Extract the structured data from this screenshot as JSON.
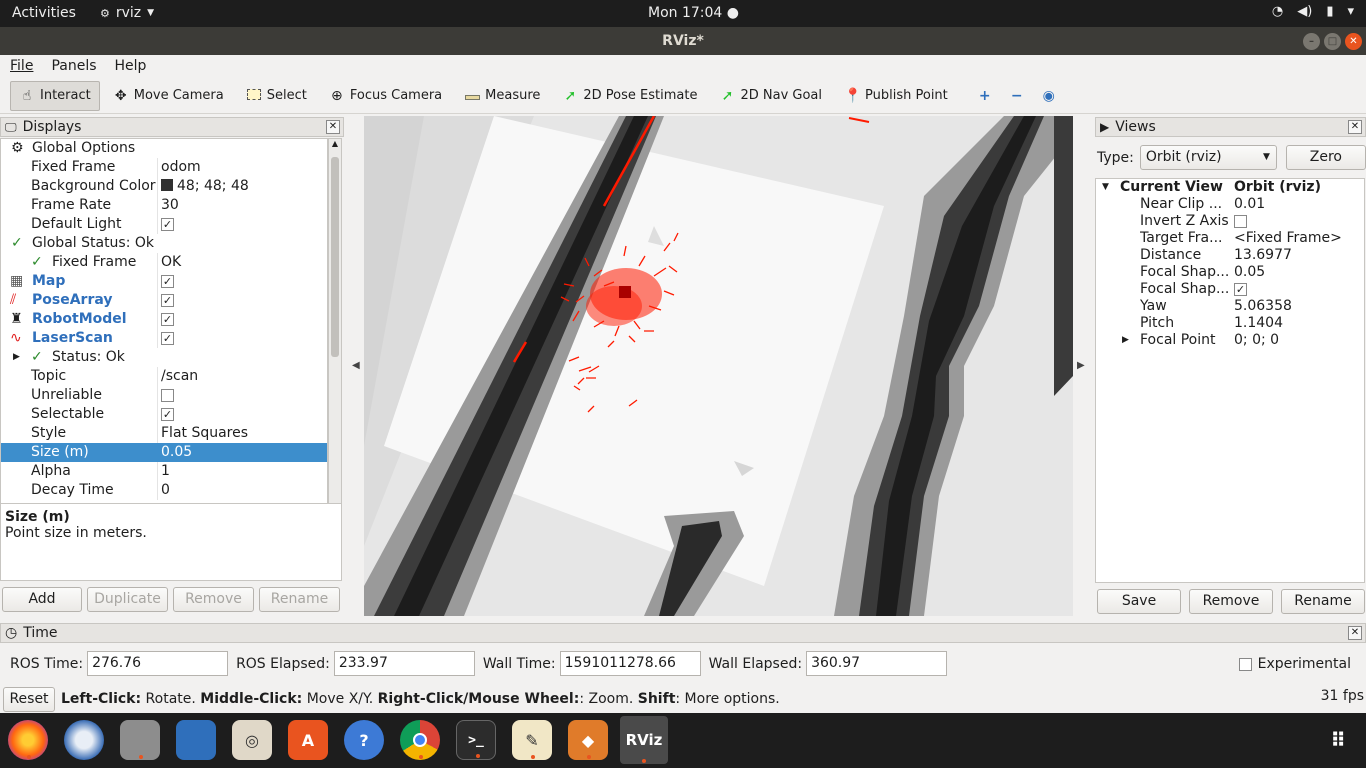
{
  "topbar": {
    "activities": "Activities",
    "app_name": "rviz",
    "clock": "Mon 17:04 ●",
    "tray": [
      "wifi",
      "volume",
      "battery",
      "power"
    ]
  },
  "window": {
    "title": "RViz*"
  },
  "menu": [
    "File",
    "Panels",
    "Help"
  ],
  "toolbar": {
    "tools": [
      {
        "label": "Interact",
        "icon": "hand-icon"
      },
      {
        "label": "Move Camera",
        "icon": "move-camera-icon"
      },
      {
        "label": "Select",
        "icon": "select-icon"
      },
      {
        "label": "Focus Camera",
        "icon": "focus-camera-icon"
      },
      {
        "label": "Measure",
        "icon": "ruler-icon"
      },
      {
        "label": "2D Pose Estimate",
        "icon": "pose-arrow-icon"
      },
      {
        "label": "2D Nav Goal",
        "icon": "nav-goal-icon"
      },
      {
        "label": "Publish Point",
        "icon": "map-pin-icon"
      }
    ]
  },
  "displays": {
    "title": "Displays",
    "rows": [
      {
        "k": "Global Options",
        "v": ""
      },
      {
        "k": "Fixed Frame",
        "v": "odom"
      },
      {
        "k": "Background Color",
        "v": "48; 48; 48"
      },
      {
        "k": "Frame Rate",
        "v": "30"
      },
      {
        "k": "Default Light",
        "v": ""
      },
      {
        "k": "Global Status: Ok",
        "v": ""
      },
      {
        "k": "Fixed Frame",
        "v": "OK"
      },
      {
        "k": "Map",
        "v": ""
      },
      {
        "k": "PoseArray",
        "v": ""
      },
      {
        "k": "RobotModel",
        "v": ""
      },
      {
        "k": "LaserScan",
        "v": ""
      },
      {
        "k": "Status: Ok",
        "v": ""
      },
      {
        "k": "Topic",
        "v": "/scan"
      },
      {
        "k": "Unreliable",
        "v": ""
      },
      {
        "k": "Selectable",
        "v": ""
      },
      {
        "k": "Style",
        "v": "Flat Squares"
      },
      {
        "k": "Size (m)",
        "v": "0.05"
      },
      {
        "k": "Alpha",
        "v": "1"
      },
      {
        "k": "Decay Time",
        "v": "0"
      }
    ],
    "desc_title": "Size (m)",
    "desc_text": "Point size in meters.",
    "buttons": [
      "Add",
      "Duplicate",
      "Remove",
      "Rename"
    ]
  },
  "views": {
    "title": "Views",
    "type_label": "Type:",
    "type_value": "Orbit (rviz)",
    "zero": "Zero",
    "current_view": "Current View",
    "current_view_type": "Orbit (rviz)",
    "rows": [
      {
        "k": "Near Clip ...",
        "v": "0.01"
      },
      {
        "k": "Invert Z Axis",
        "v": ""
      },
      {
        "k": "Target Fra...",
        "v": "<Fixed Frame>"
      },
      {
        "k": "Distance",
        "v": "13.6977"
      },
      {
        "k": "Focal Shap...",
        "v": "0.05"
      },
      {
        "k": "Focal Shap...",
        "v": ""
      },
      {
        "k": "Yaw",
        "v": "5.06358"
      },
      {
        "k": "Pitch",
        "v": "1.1404"
      },
      {
        "k": "Focal Point",
        "v": "0; 0; 0"
      }
    ],
    "buttons": [
      "Save",
      "Remove",
      "Rename"
    ]
  },
  "time": {
    "title": "Time",
    "ros_time_label": "ROS Time:",
    "ros_time": "276.76",
    "ros_elapsed_label": "ROS Elapsed:",
    "ros_elapsed": "233.97",
    "wall_time_label": "Wall Time:",
    "wall_time": "1591011278.66",
    "wall_elapsed_label": "Wall Elapsed:",
    "wall_elapsed": "360.97",
    "experimental": "Experimental"
  },
  "status": {
    "reset": "Reset",
    "b1": "Left-Click:",
    "t1": " Rotate. ",
    "b2": "Middle-Click:",
    "t2": " Move X/Y. ",
    "b3": "Right-Click/Mouse Wheel:",
    "t3": ": Zoom. ",
    "b4": "Shift",
    "t4": ": More options.",
    "fps": "31 fps"
  },
  "dock": {
    "rviz_label": "RViz"
  },
  "colors": {
    "accent": "#3d8ecc",
    "particles": "#ff1a00",
    "map_free": "#f8f8f8",
    "map_unknown": "#dcdcdc",
    "wall": "#1c1c1c"
  }
}
